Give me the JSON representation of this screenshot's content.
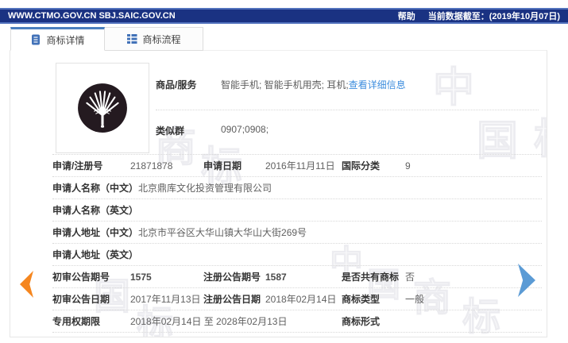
{
  "topbar": {
    "site_urls": "WWW.CTMO.GOV.CN SBJ.SAIC.GOV.CN",
    "help_label": "帮助",
    "data_current_label": "当前数据截至：(2019年10月07日)"
  },
  "tabs": [
    {
      "label": "商标详情",
      "active": true
    },
    {
      "label": "商标流程",
      "active": false
    }
  ],
  "trademark": {
    "goods_label": "商品/服务",
    "goods_value": "智能手机; 智能手机用壳; 耳机; ",
    "goods_detail_link": "查看详细信息",
    "similar_group_label": "类似群",
    "similar_group_value": "0907;0908;"
  },
  "details": {
    "reg_no_label": "申请/注册号",
    "reg_no": "21871878",
    "apply_date_label": "申请日期",
    "apply_date": "2016年11月11日",
    "intl_class_label": "国际分类",
    "intl_class": "9",
    "applicant_cn_label": "申请人名称（中文）",
    "applicant_cn": "北京鼎库文化投资管理有限公司",
    "applicant_en_label": "申请人名称（英文）",
    "applicant_en": "",
    "address_cn_label": "申请人地址（中文）",
    "address_cn": "北京市平谷区大华山镇大华山大街269号",
    "address_en_label": "申请人地址（英文）",
    "address_en": "",
    "prelim_no_label": "初审公告期号",
    "prelim_no": "1575",
    "reg_notice_no_label": "注册公告期号",
    "reg_notice_no": "1587",
    "shared_label": "是否共有商标",
    "shared": "否",
    "prelim_date_label": "初审公告日期",
    "prelim_date": "2017年11月13日",
    "reg_notice_date_label": "注册公告日期",
    "reg_notice_date": "2018年02月14日",
    "tm_type_label": "商标类型",
    "tm_type": "一般",
    "term_label": "专用权期限",
    "term": "2018年02月14日 至 2028年02月13日",
    "tm_form_label": "商标形式",
    "tm_form": ""
  },
  "watermark": {
    "chars": [
      "中",
      "国",
      "商",
      "标"
    ]
  },
  "colors": {
    "topbar_bg": "#1a3282",
    "topbar_edge": "#5272bd",
    "tab_accent": "#4b7fbe",
    "link_blue": "#3e8ede",
    "arrow_prev_orange": "#f5861f",
    "arrow_next_blue": "#5b9bd5"
  }
}
